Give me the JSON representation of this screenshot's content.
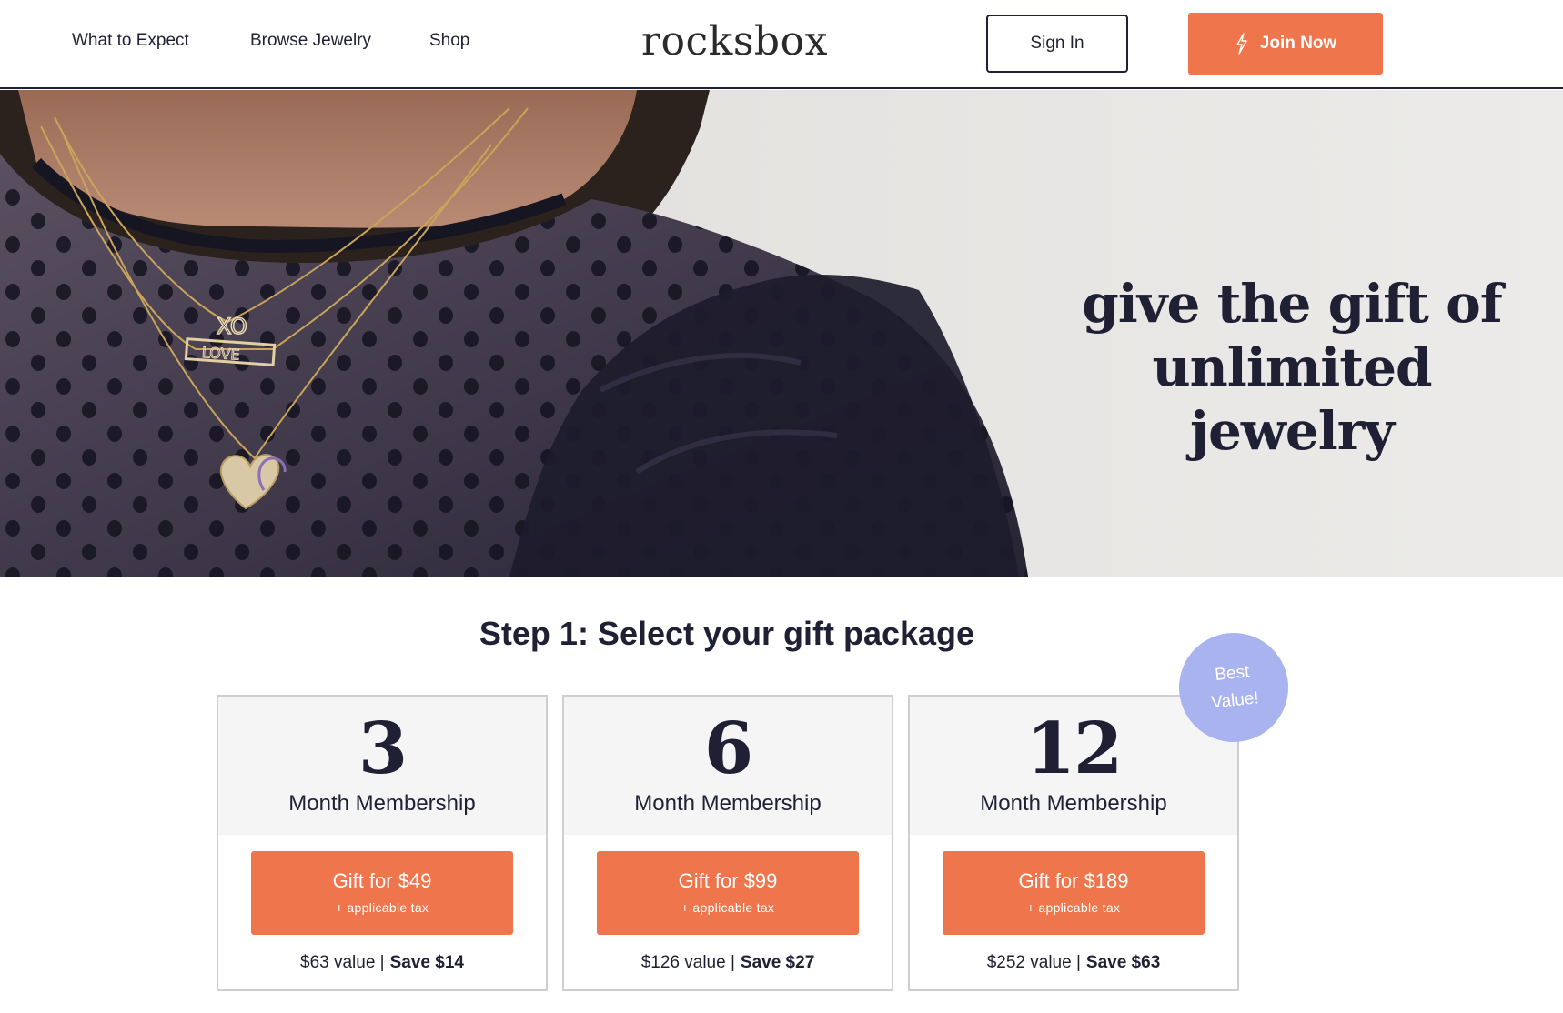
{
  "header": {
    "nav": [
      "What to Expect",
      "Browse Jewelry",
      "Shop"
    ],
    "logo": "rocksbox",
    "signin_label": "Sign In",
    "join_label": "Join Now",
    "join_icon": "lightning-bolt-icon"
  },
  "hero": {
    "line1": "give the gift of",
    "line2": "unlimited jewelry",
    "pendant_text_1": "XO",
    "pendant_text_2": "LOVE"
  },
  "step": {
    "title": "Step 1: Select your gift package"
  },
  "badge": {
    "line1": "Best",
    "line2": "Value!"
  },
  "packages": [
    {
      "months": "3",
      "label": "Month Membership",
      "gift": "Gift for $49",
      "tax": "+ applicable tax",
      "value": "$63 value |",
      "save": "Save $14"
    },
    {
      "months": "6",
      "label": "Month Membership",
      "gift": "Gift for $99",
      "tax": "+ applicable tax",
      "value": "$126 value |",
      "save": "Save $27"
    },
    {
      "months": "12",
      "label": "Month Membership",
      "gift": "Gift for $189",
      "tax": "+ applicable tax",
      "value": "$252 value |",
      "save": "Save $63"
    }
  ],
  "colors": {
    "accent": "#ef754c",
    "navy": "#1f2033",
    "badge": "#a9b3f0"
  }
}
